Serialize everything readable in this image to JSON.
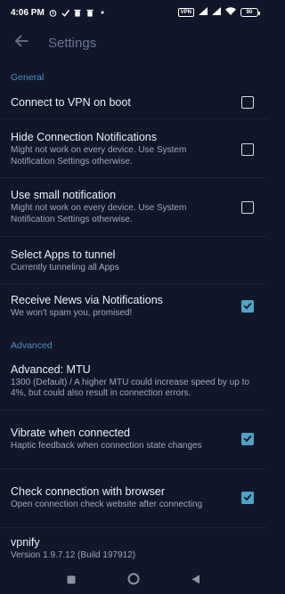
{
  "status_bar": {
    "time": "4:06 PM",
    "vpn_badge": "VPN",
    "battery": "90",
    "icons": [
      "alarm-icon",
      "check-icon",
      "trash-icon",
      "trash-icon",
      "dot-icon",
      "signal-icon",
      "signal-icon",
      "wifi-icon",
      "battery-icon"
    ]
  },
  "toolbar": {
    "title": "Settings",
    "back_icon": "arrow-back-icon"
  },
  "sections": {
    "general": "General",
    "advanced": "Advanced"
  },
  "prefs": {
    "vpn_on_boot": {
      "title": "Connect to VPN on boot",
      "checked": false
    },
    "hide_notifications": {
      "title": "Hide Connection Notifications",
      "summary": "Might not work on every device. Use System Notification Settings otherwise.",
      "checked": false
    },
    "small_notification": {
      "title": "Use small notification",
      "summary": "Might not work on every device. Use System Notification Settings otherwise.",
      "checked": false
    },
    "select_apps": {
      "title": "Select Apps to tunnel",
      "summary": "Currently tunneling all Apps"
    },
    "receive_news": {
      "title": "Receive News via Notifications",
      "summary": "We won't spam you, promised!",
      "checked": true
    },
    "mtu": {
      "title": "Advanced: MTU",
      "summary": "1300 (Default) / A higher MTU could increase speed by up to 4%, but could also result in connection errors."
    },
    "vibrate": {
      "title": "Vibrate when connected",
      "summary": "Haptic feedback when connection state changes",
      "checked": true
    },
    "check_browser": {
      "title": "Check connection with browser",
      "summary": "Open connection check website after connecting",
      "checked": true
    },
    "about": {
      "title": "vpnify",
      "summary": "Version 1.9.7.12 (Build 197912)"
    }
  },
  "nav_bar": {
    "recents": "square-icon",
    "home": "circle-icon",
    "back": "triangle-back-icon"
  },
  "colors": {
    "background": "#111729",
    "accent": "#4fa3c7",
    "section_header": "#4e8fc0",
    "title_text": "#edf0f6",
    "summary_text": "#a3a9b8"
  }
}
